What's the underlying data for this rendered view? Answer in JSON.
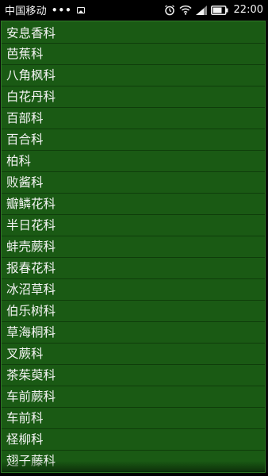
{
  "status_bar": {
    "carrier": "中国移动",
    "dots": "•••",
    "time": "22:00",
    "icons": [
      "image-icon",
      "alarm-icon",
      "wifi-icon",
      "signal-icon",
      "battery-icon"
    ]
  },
  "colors": {
    "list_background": "#1a5a14",
    "divider": "#0f3d0b",
    "text": "#f4f4f4",
    "status_bar": "#000000"
  },
  "list": {
    "items": [
      "安息香科",
      "芭蕉科",
      "八角枫科",
      "白花丹科",
      "百部科",
      "百合科",
      "柏科",
      "败酱科",
      "瓣鳞花科",
      "半日花科",
      "蚌壳蕨科",
      "报春花科",
      "冰沼草科",
      "伯乐树科",
      "草海桐科",
      "叉蕨科",
      "茶茱萸科",
      "车前蕨科",
      "车前科",
      "柽柳科",
      "翅子藤科"
    ]
  }
}
